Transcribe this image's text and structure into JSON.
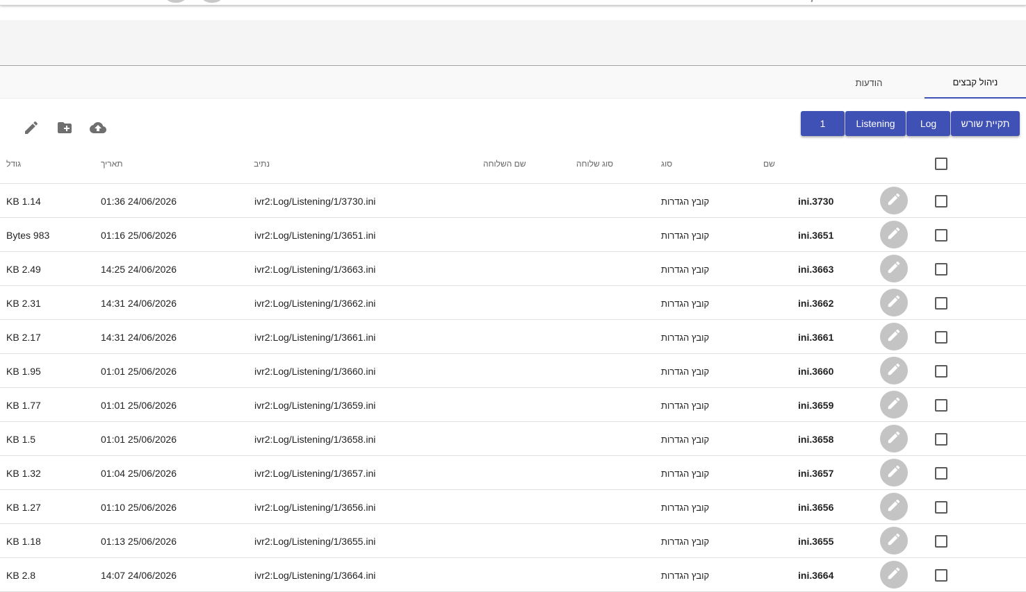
{
  "tabs": [
    {
      "label": "ניהול קבצים",
      "active": true
    },
    {
      "label": "הודעות",
      "active": false
    }
  ],
  "breadcrumbs": [
    "תקיית שורש",
    "Log",
    "Listening",
    "1"
  ],
  "toolbar": {
    "icons": [
      "edit-icon",
      "create-folder-icon",
      "cloud-upload-icon"
    ]
  },
  "table": {
    "columns": {
      "name": "שם",
      "type": "סוג",
      "ext_type": "סוג שלוחה",
      "ext_name": "שם השלוחה",
      "path": "נתיב",
      "date": "תאריך",
      "size": "גודל"
    },
    "rows": [
      {
        "name": "ini.3730",
        "type": "קובץ הגדרות",
        "path": "ivr2:Log/Listening/1/3730.ini",
        "date": "01:36 24/06/2026",
        "size": "KB 1.14"
      },
      {
        "name": "ini.3651",
        "type": "קובץ הגדרות",
        "path": "ivr2:Log/Listening/1/3651.ini",
        "date": "01:16 25/06/2026",
        "size": "Bytes 983"
      },
      {
        "name": "ini.3663",
        "type": "קובץ הגדרות",
        "path": "ivr2:Log/Listening/1/3663.ini",
        "date": "14:25 24/06/2026",
        "size": "KB 2.49"
      },
      {
        "name": "ini.3662",
        "type": "קובץ הגדרות",
        "path": "ivr2:Log/Listening/1/3662.ini",
        "date": "14:31 24/06/2026",
        "size": "KB 2.31"
      },
      {
        "name": "ini.3661",
        "type": "קובץ הגדרות",
        "path": "ivr2:Log/Listening/1/3661.ini",
        "date": "14:31 24/06/2026",
        "size": "KB 2.17"
      },
      {
        "name": "ini.3660",
        "type": "קובץ הגדרות",
        "path": "ivr2:Log/Listening/1/3660.ini",
        "date": "01:01 25/06/2026",
        "size": "KB 1.95"
      },
      {
        "name": "ini.3659",
        "type": "קובץ הגדרות",
        "path": "ivr2:Log/Listening/1/3659.ini",
        "date": "01:01 25/06/2026",
        "size": "KB 1.77"
      },
      {
        "name": "ini.3658",
        "type": "קובץ הגדרות",
        "path": "ivr2:Log/Listening/1/3658.ini",
        "date": "01:01 25/06/2026",
        "size": "KB 1.5"
      },
      {
        "name": "ini.3657",
        "type": "קובץ הגדרות",
        "path": "ivr2:Log/Listening/1/3657.ini",
        "date": "01:04 25/06/2026",
        "size": "KB 1.32"
      },
      {
        "name": "ini.3656",
        "type": "קובץ הגדרות",
        "path": "ivr2:Log/Listening/1/3656.ini",
        "date": "01:10 25/06/2026",
        "size": "KB 1.27"
      },
      {
        "name": "ini.3655",
        "type": "קובץ הגדרות",
        "path": "ivr2:Log/Listening/1/3655.ini",
        "date": "01:13 25/06/2026",
        "size": "KB 1.18"
      },
      {
        "name": "ini.3664",
        "type": "קובץ הגדרות",
        "path": "ivr2:Log/Listening/1/3664.ini",
        "date": "14:07 24/06/2026",
        "size": "KB 2.8"
      }
    ]
  },
  "colors": {
    "primary": "#3f51b5",
    "icon": "#6f6f6f",
    "fab": "#c4c4c4"
  }
}
